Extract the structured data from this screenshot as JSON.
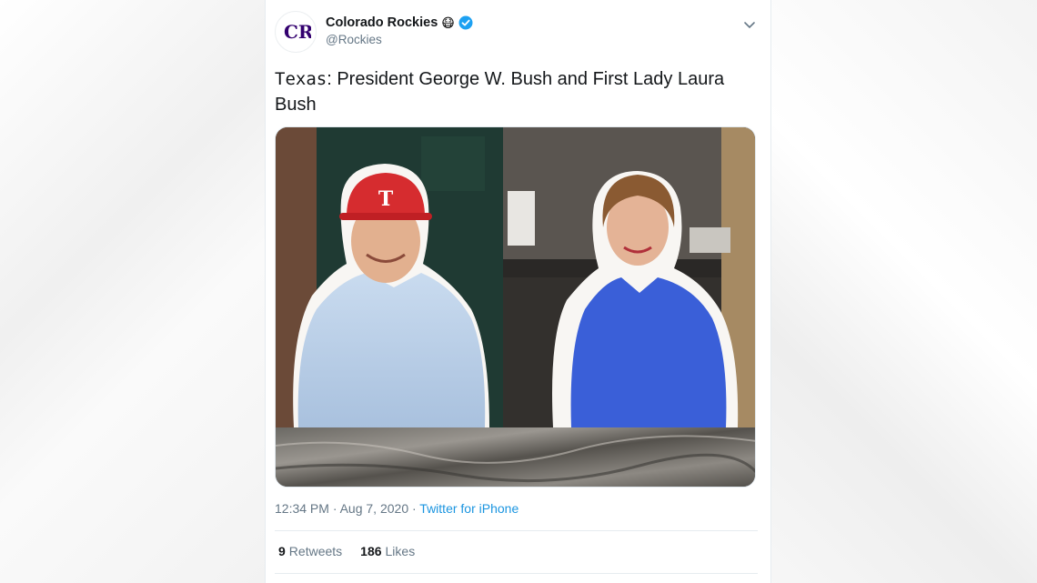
{
  "tweet": {
    "author": {
      "name": "Colorado Rockies",
      "emoji": "😷",
      "handle": "@Rockies",
      "avatar_letters": "CR"
    },
    "text": {
      "prefix": "Texas",
      "body": ": President George W. Bush and First Lady Laura Bush"
    },
    "timestamp": "12:34 PM · Aug 7, 2020 · ",
    "source": "Twitter for iPhone",
    "stats": {
      "retweets_count": "9",
      "retweets_label": "Retweets",
      "likes_count": "186",
      "likes_label": "Likes"
    },
    "photo": {
      "cap_letter": "T"
    }
  },
  "colors": {
    "verified": "#1da1f2",
    "link": "#1b95e0",
    "cap_red": "#d62c2f",
    "dress_blue": "#3a5fd8"
  }
}
